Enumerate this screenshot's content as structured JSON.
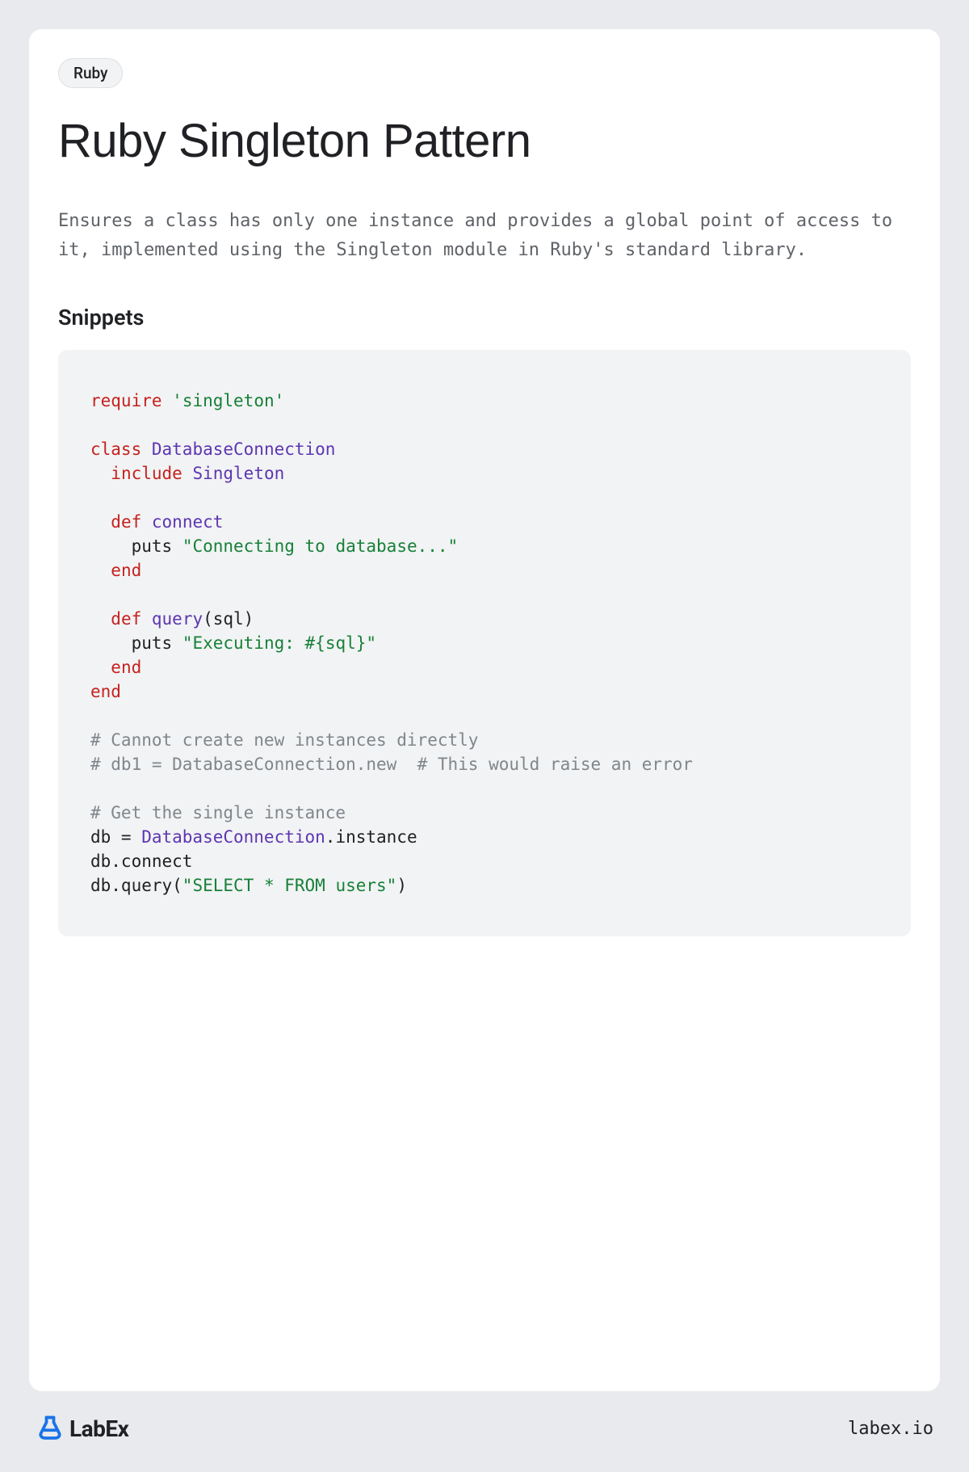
{
  "tag": "Ruby",
  "title": "Ruby Singleton Pattern",
  "description": "Ensures a class has only one instance and provides a global point of access to it, implemented using the Singleton module in Ruby's standard library.",
  "snippetsHeading": "Snippets",
  "code": {
    "require": "require",
    "singletonStr": "'singleton'",
    "class": "class",
    "className": "DatabaseConnection",
    "include": "include",
    "singletonModule": "Singleton",
    "def": "def",
    "connect": "connect",
    "puts1": "puts",
    "connectStr": "\"Connecting to database...\"",
    "end": "end",
    "query": "query",
    "queryArgs": "(sql)",
    "executingStr": "\"Executing: #{sql}\"",
    "comment1": "# Cannot create new instances directly",
    "comment2": "# db1 = DatabaseConnection.new  # This would raise an error",
    "comment3": "# Get the single instance",
    "dbAssign": "db = ",
    "dbClassRef": "DatabaseConnection",
    "instanceCall": ".instance",
    "dbConnect": "db.connect",
    "dbQuery": "db.query(",
    "selectStr": "\"SELECT * FROM users\"",
    "closeParen": ")"
  },
  "footer": {
    "logoText": "LabEx",
    "url": "labex.io"
  }
}
